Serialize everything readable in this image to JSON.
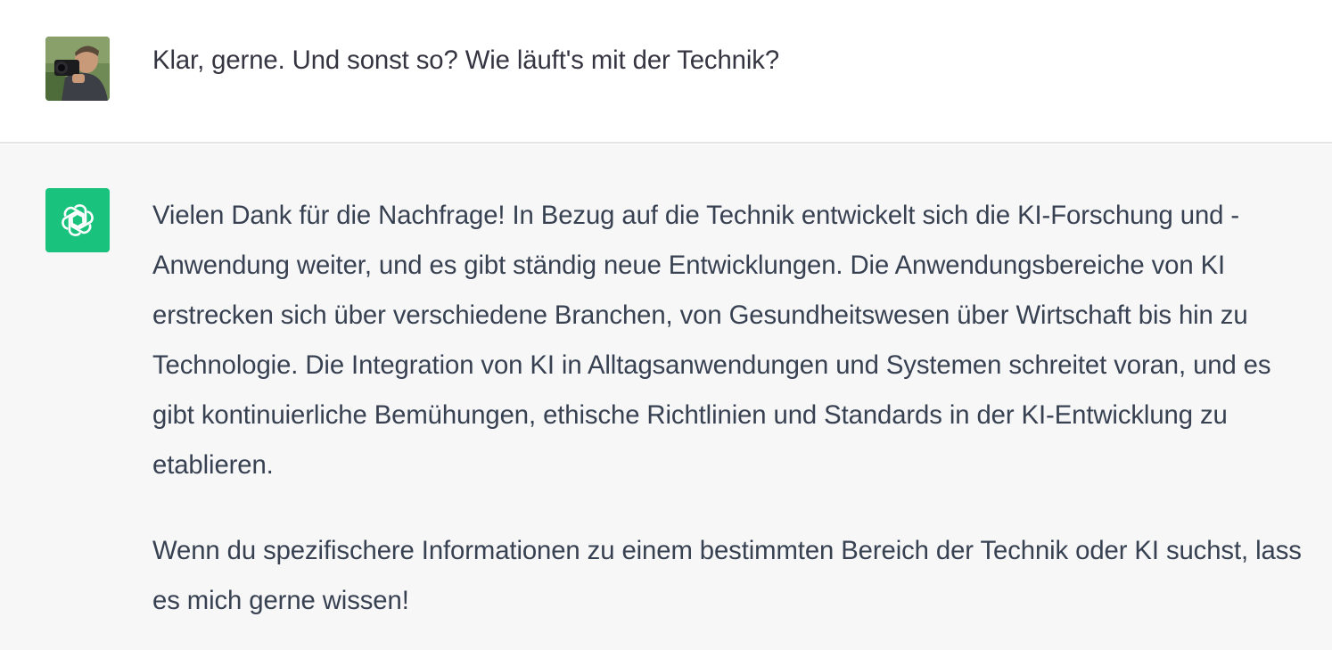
{
  "conversation": {
    "user_message": {
      "avatar": "user-photo-avatar",
      "text": "Klar, gerne. Und sonst so? Wie läuft's mit der Technik?"
    },
    "assistant_message": {
      "avatar": "openai-logo-icon",
      "paragraphs": [
        "Vielen Dank für die Nachfrage! In Bezug auf die Technik entwickelt sich die KI-Forschung und -Anwendung weiter, und es gibt ständig neue Entwicklungen. Die Anwendungsbereiche von KI erstrecken sich über verschiedene Branchen, von Gesundheitswesen über Wirtschaft bis hin zu Technologie. Die Integration von KI in Alltagsanwendungen und Systemen schreitet voran, und es gibt kontinuierliche Bemühungen, ethische Richtlinien und Standards in der KI-Entwicklung zu etablieren.",
        "Wenn du spezifischere Informationen zu einem bestimmten Bereich der Technik oder KI suchst, lass es mich gerne wissen!"
      ]
    }
  },
  "colors": {
    "user_bg": "#ffffff",
    "assistant_bg": "#f7f7f8",
    "assistant_avatar_bg": "#19c37d",
    "text": "#374151"
  }
}
